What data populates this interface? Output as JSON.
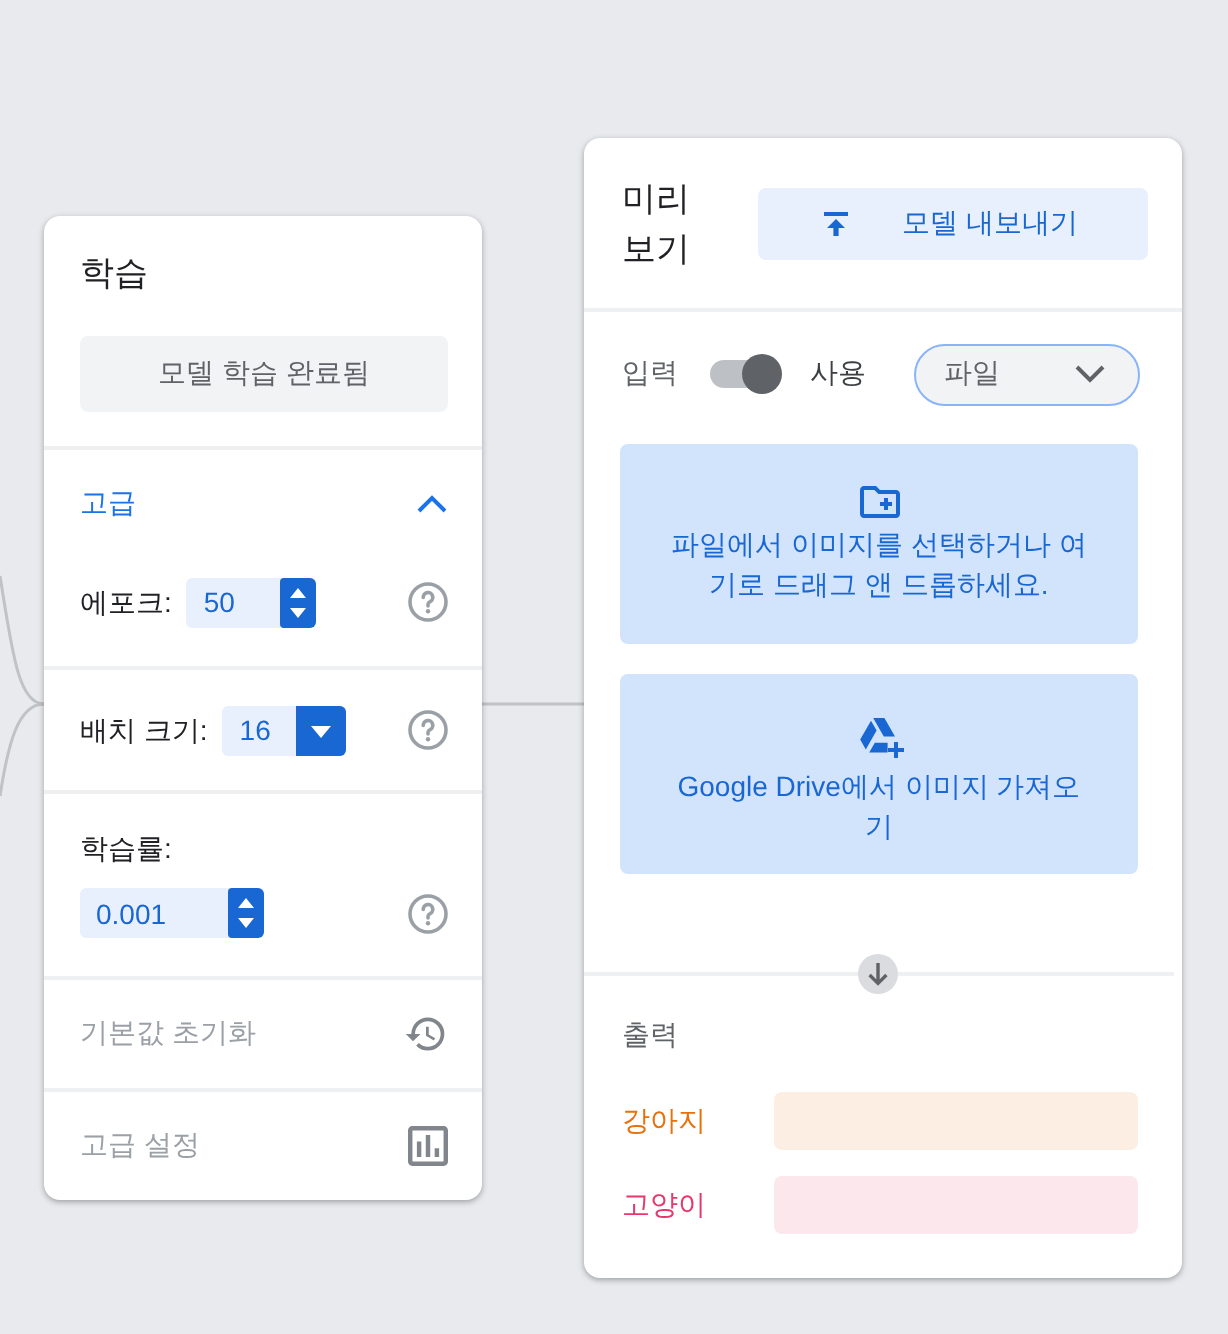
{
  "training": {
    "title": "학습",
    "train_button": {
      "label": "모델 학습 완료됨",
      "disabled": true
    },
    "advanced": {
      "label": "고급",
      "expanded": true,
      "params": [
        {
          "label": "에포크:",
          "value": "50",
          "kind": "spinner"
        },
        {
          "label": "배치 크기:",
          "value": "16",
          "kind": "select"
        },
        {
          "label": "학습률:",
          "value": "0.001",
          "kind": "decimal"
        }
      ]
    },
    "actions": [
      {
        "label": "기본값 초기화",
        "disabled": true
      },
      {
        "label": "고급 설정",
        "disabled": true
      }
    ]
  },
  "preview": {
    "title": "미리 보기",
    "export_button": {
      "label": "모델 내보내기"
    },
    "input": {
      "label": "입력",
      "toggle": {
        "label": "사용",
        "on": true
      },
      "source": {
        "value": "파일"
      }
    },
    "sources": [
      {
        "label": "파일에서 이미지를 선택하거나 여기로 드래그 앤 드롭하세요."
      },
      {
        "label": "Google Drive에서 이미지 가져오기"
      }
    ],
    "output": {
      "label": "출력",
      "classes": [
        {
          "name": "강아지",
          "color": "#e8710a"
        },
        {
          "name": "고양이",
          "color": "#e5386d"
        }
      ]
    }
  }
}
